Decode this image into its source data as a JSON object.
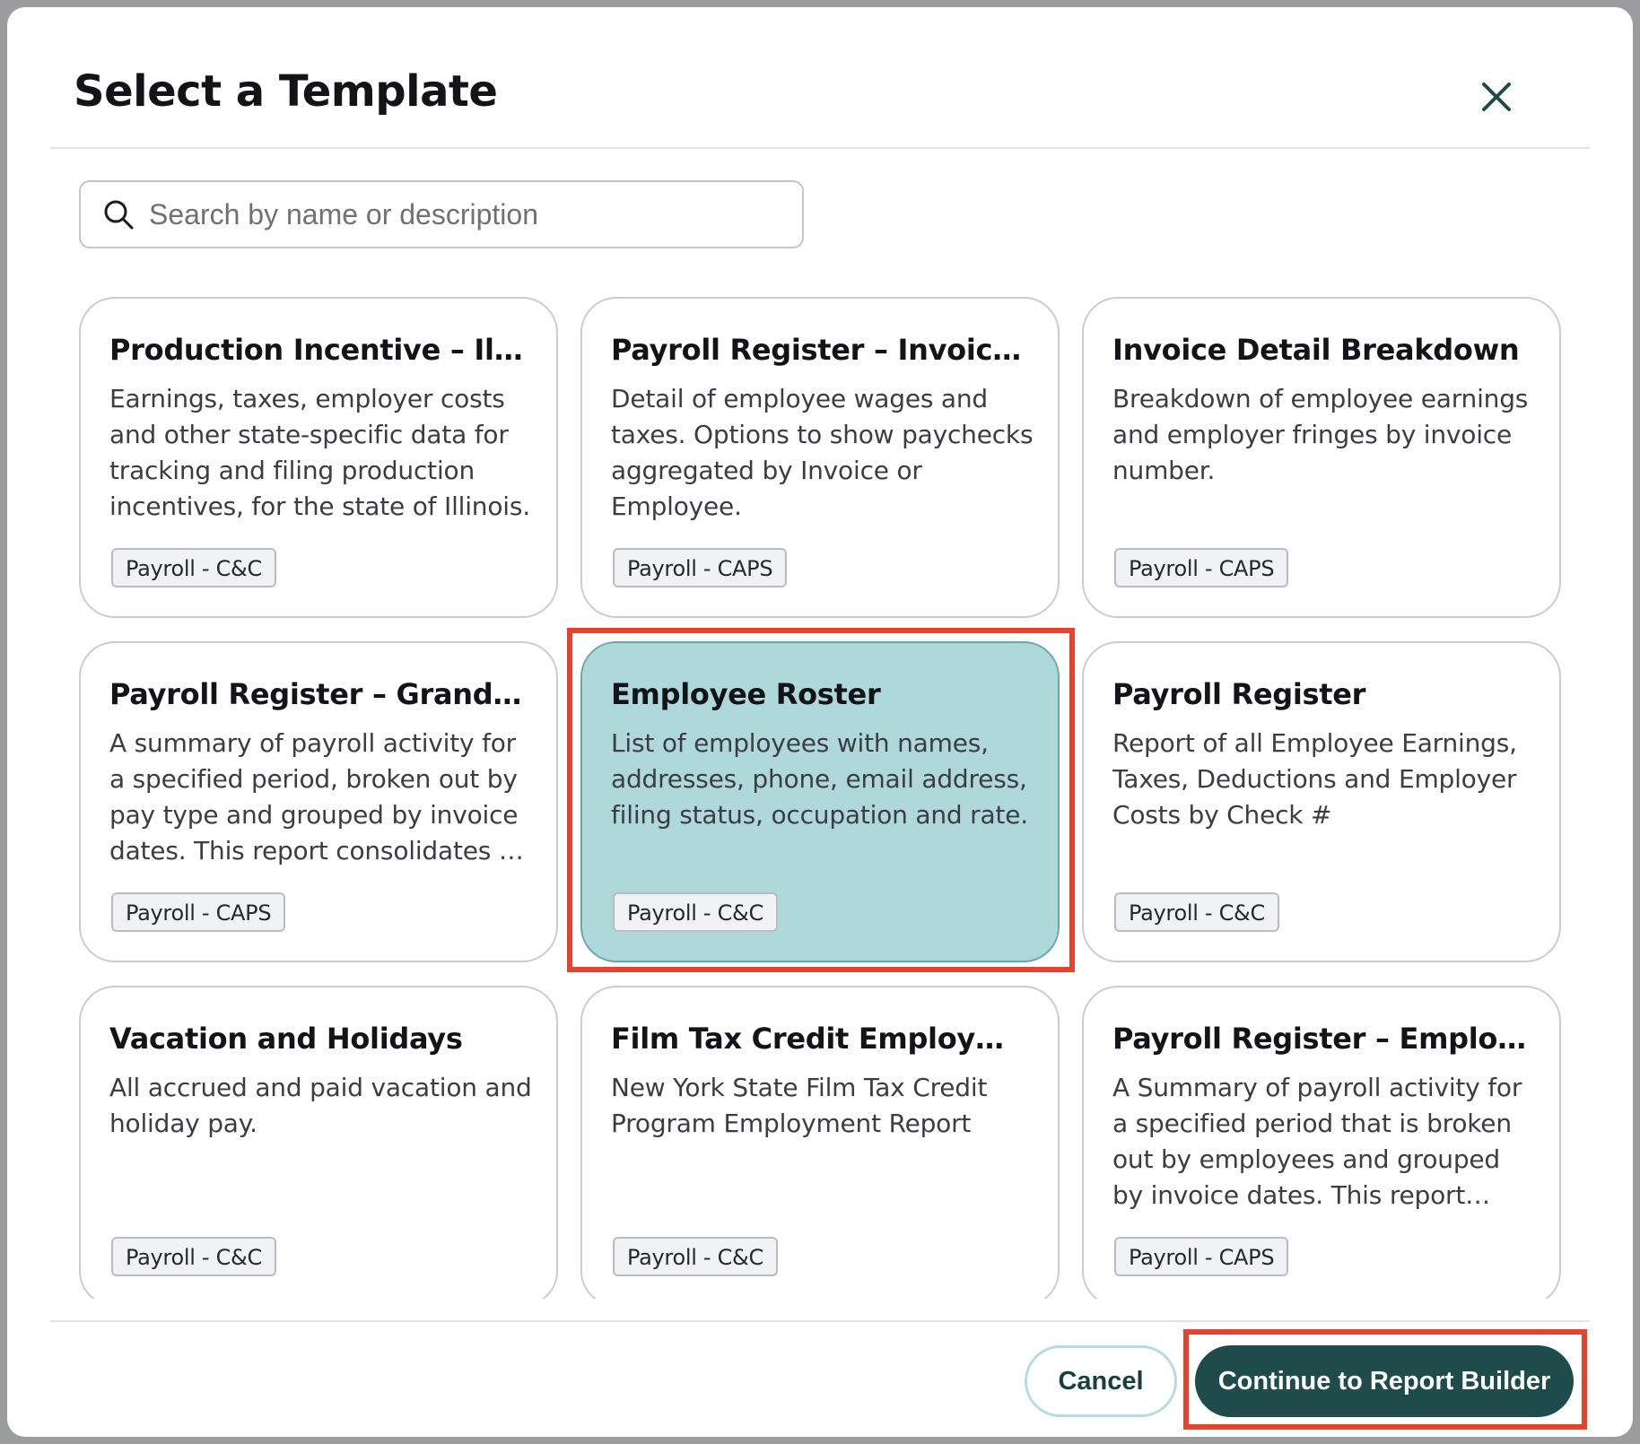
{
  "modal": {
    "title": "Select a Template",
    "close_icon": "close-icon"
  },
  "search": {
    "placeholder": "Search by name or description",
    "value": "",
    "icon": "search-icon"
  },
  "templates": [
    {
      "title": "Production Incentive – Illinois",
      "description": "Earnings, taxes, employer costs and other state-specific data for tracking and filing production incentives, for the state of Illinois.",
      "tag": "Payroll - C&C",
      "selected": false
    },
    {
      "title": "Payroll Register – Invoice Detail",
      "description": "Detail of employee wages and taxes. Options to show paychecks aggregated by Invoice or Employee.",
      "tag": "Payroll - CAPS",
      "selected": false
    },
    {
      "title": "Invoice Detail Breakdown",
      "description": "Breakdown of employee earnings and employer fringes by invoice number.",
      "tag": "Payroll - CAPS",
      "selected": false
    },
    {
      "title": "Payroll Register – Grand Total",
      "description": "A summary of payroll activity for a specified period, broken out by pay type and grouped by invoice dates. This report consolidates all data.",
      "tag": "Payroll - CAPS",
      "selected": false
    },
    {
      "title": "Employee Roster",
      "description": "List of employees with names, addresses, phone, email address, filing status, occupation and rate.",
      "tag": "Payroll - C&C",
      "selected": true
    },
    {
      "title": "Payroll Register",
      "description": "Report of all Employee Earnings, Taxes, Deductions and Employer Costs by Check #",
      "tag": "Payroll - C&C",
      "selected": false
    },
    {
      "title": "Vacation and Holidays",
      "description": "All accrued and paid vacation and holiday pay.",
      "tag": "Payroll - C&C",
      "selected": false
    },
    {
      "title": "Film Tax Credit Employment Report",
      "description": "New York State Film Tax Credit Program Employment Report",
      "tag": "Payroll - C&C",
      "selected": false
    },
    {
      "title": "Payroll Register – Employee Detail",
      "description": "A Summary of payroll activity for a specified period that is broken out by employees and grouped by invoice dates. This report consolidates all data.",
      "tag": "Payroll - CAPS",
      "selected": false
    }
  ],
  "footer": {
    "cancel_label": "Cancel",
    "continue_label": "Continue to Report Builder"
  },
  "colors": {
    "selected_card": "#afd8da",
    "primary_button": "#1d4c4b",
    "highlight": "#e5432e"
  }
}
